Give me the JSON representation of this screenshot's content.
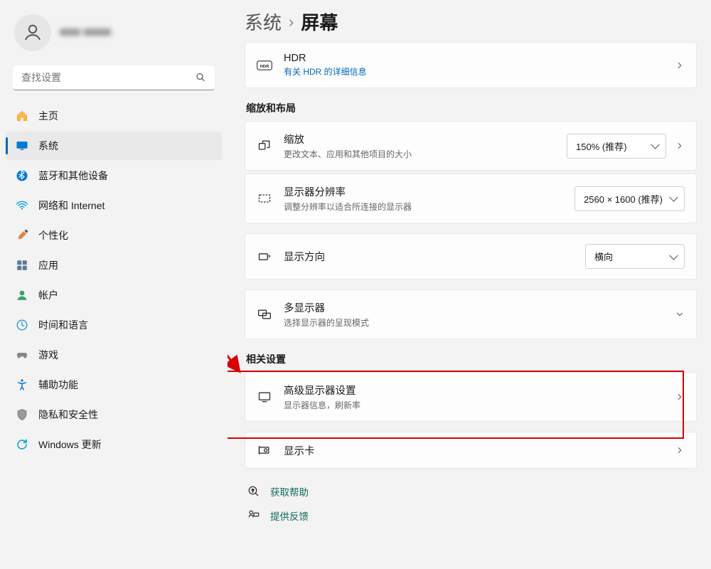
{
  "user": {
    "masked_name": "■■■ ■■■■"
  },
  "search": {
    "placeholder": "查找设置"
  },
  "sidebar": {
    "items": [
      {
        "label": "主页",
        "icon": "home",
        "active": false
      },
      {
        "label": "系统",
        "icon": "system",
        "active": true
      },
      {
        "label": "蓝牙和其他设备",
        "icon": "bluetooth",
        "active": false
      },
      {
        "label": "网络和 Internet",
        "icon": "wifi",
        "active": false
      },
      {
        "label": "个性化",
        "icon": "brush",
        "active": false
      },
      {
        "label": "应用",
        "icon": "apps",
        "active": false
      },
      {
        "label": "帐户",
        "icon": "account",
        "active": false
      },
      {
        "label": "时间和语言",
        "icon": "time",
        "active": false
      },
      {
        "label": "游戏",
        "icon": "gaming",
        "active": false
      },
      {
        "label": "辅助功能",
        "icon": "accessibility",
        "active": false
      },
      {
        "label": "隐私和安全性",
        "icon": "privacy",
        "active": false
      },
      {
        "label": "Windows 更新",
        "icon": "update",
        "active": false
      }
    ]
  },
  "breadcrumb": {
    "parent": "系统",
    "sep": "›",
    "current": "屏幕"
  },
  "hdr": {
    "title": "HDR",
    "link_text": "有关 HDR 的详细信息",
    "icon_text": "HDR"
  },
  "section_scale": "缩放和布局",
  "scale": {
    "title": "缩放",
    "sub": "更改文本、应用和其他项目的大小",
    "value": "150% (推荐)"
  },
  "resolution": {
    "title": "显示器分辨率",
    "sub": "调整分辨率以适合所连接的显示器",
    "value": "2560 × 1600 (推荐)"
  },
  "orientation": {
    "title": "显示方向",
    "value": "横向"
  },
  "multi": {
    "title": "多显示器",
    "sub": "选择显示器的呈现模式"
  },
  "section_related": "相关设置",
  "advanced": {
    "title": "高级显示器设置",
    "sub": "显示器信息，刷新率"
  },
  "graphics": {
    "title": "显示卡"
  },
  "footer": {
    "help": "获取帮助",
    "feedback": "提供反馈"
  }
}
